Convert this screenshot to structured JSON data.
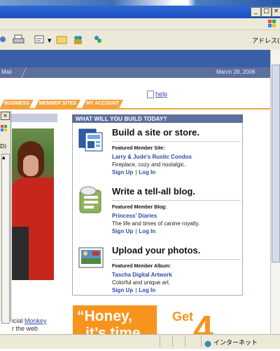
{
  "window": {
    "minimize_label": "_",
    "maximize_label": "□",
    "close_label": "×"
  },
  "toolbar": {
    "address_label": "アドレス(D)"
  },
  "site": {
    "subnav_left": "Mail",
    "date": "March 28, 2006",
    "help_label": "help",
    "tabs": [
      "BUSINESS",
      "MEMBER SITES",
      "MY ACCOUNT"
    ]
  },
  "left_panel": {
    "window_close": "×",
    "window_label": "D)",
    "text_prefix": "icial",
    "text_link": "Monkey",
    "text_suffix": "r the web"
  },
  "main": {
    "header": "WHAT WILL YOU BUILD TODAY?",
    "sections": [
      {
        "title": "Build a site or store.",
        "featured_label": "Featured Member Site:",
        "featured_link": "Larry & Jude's Rustic Condos",
        "description": "Fireplace, cozy and nostalgic.",
        "signup": "Sign Up",
        "login": "Log In"
      },
      {
        "title": "Write a tell-all blog.",
        "featured_label": "Featured Member Blog:",
        "featured_link": "Princess' Diaries",
        "description": "The life and times of canine royalty.",
        "signup": "Sign Up",
        "login": "Log In"
      },
      {
        "title": "Upload your photos.",
        "featured_label": "Featured Member Album:",
        "featured_link": "Tascha Digital Artwork",
        "description": "Colorful and unique art.",
        "signup": "Sign Up",
        "login": "Log In"
      }
    ]
  },
  "ad": {
    "line1": "“Honey,",
    "line2": "it’s time",
    "get": "Get",
    "number": "4"
  },
  "statusbar": {
    "zone": "インターネット"
  },
  "colors": {
    "accent_orange": "#f7941d",
    "nav_blue": "#3a5fa8",
    "link_blue": "#2c4aa8"
  }
}
